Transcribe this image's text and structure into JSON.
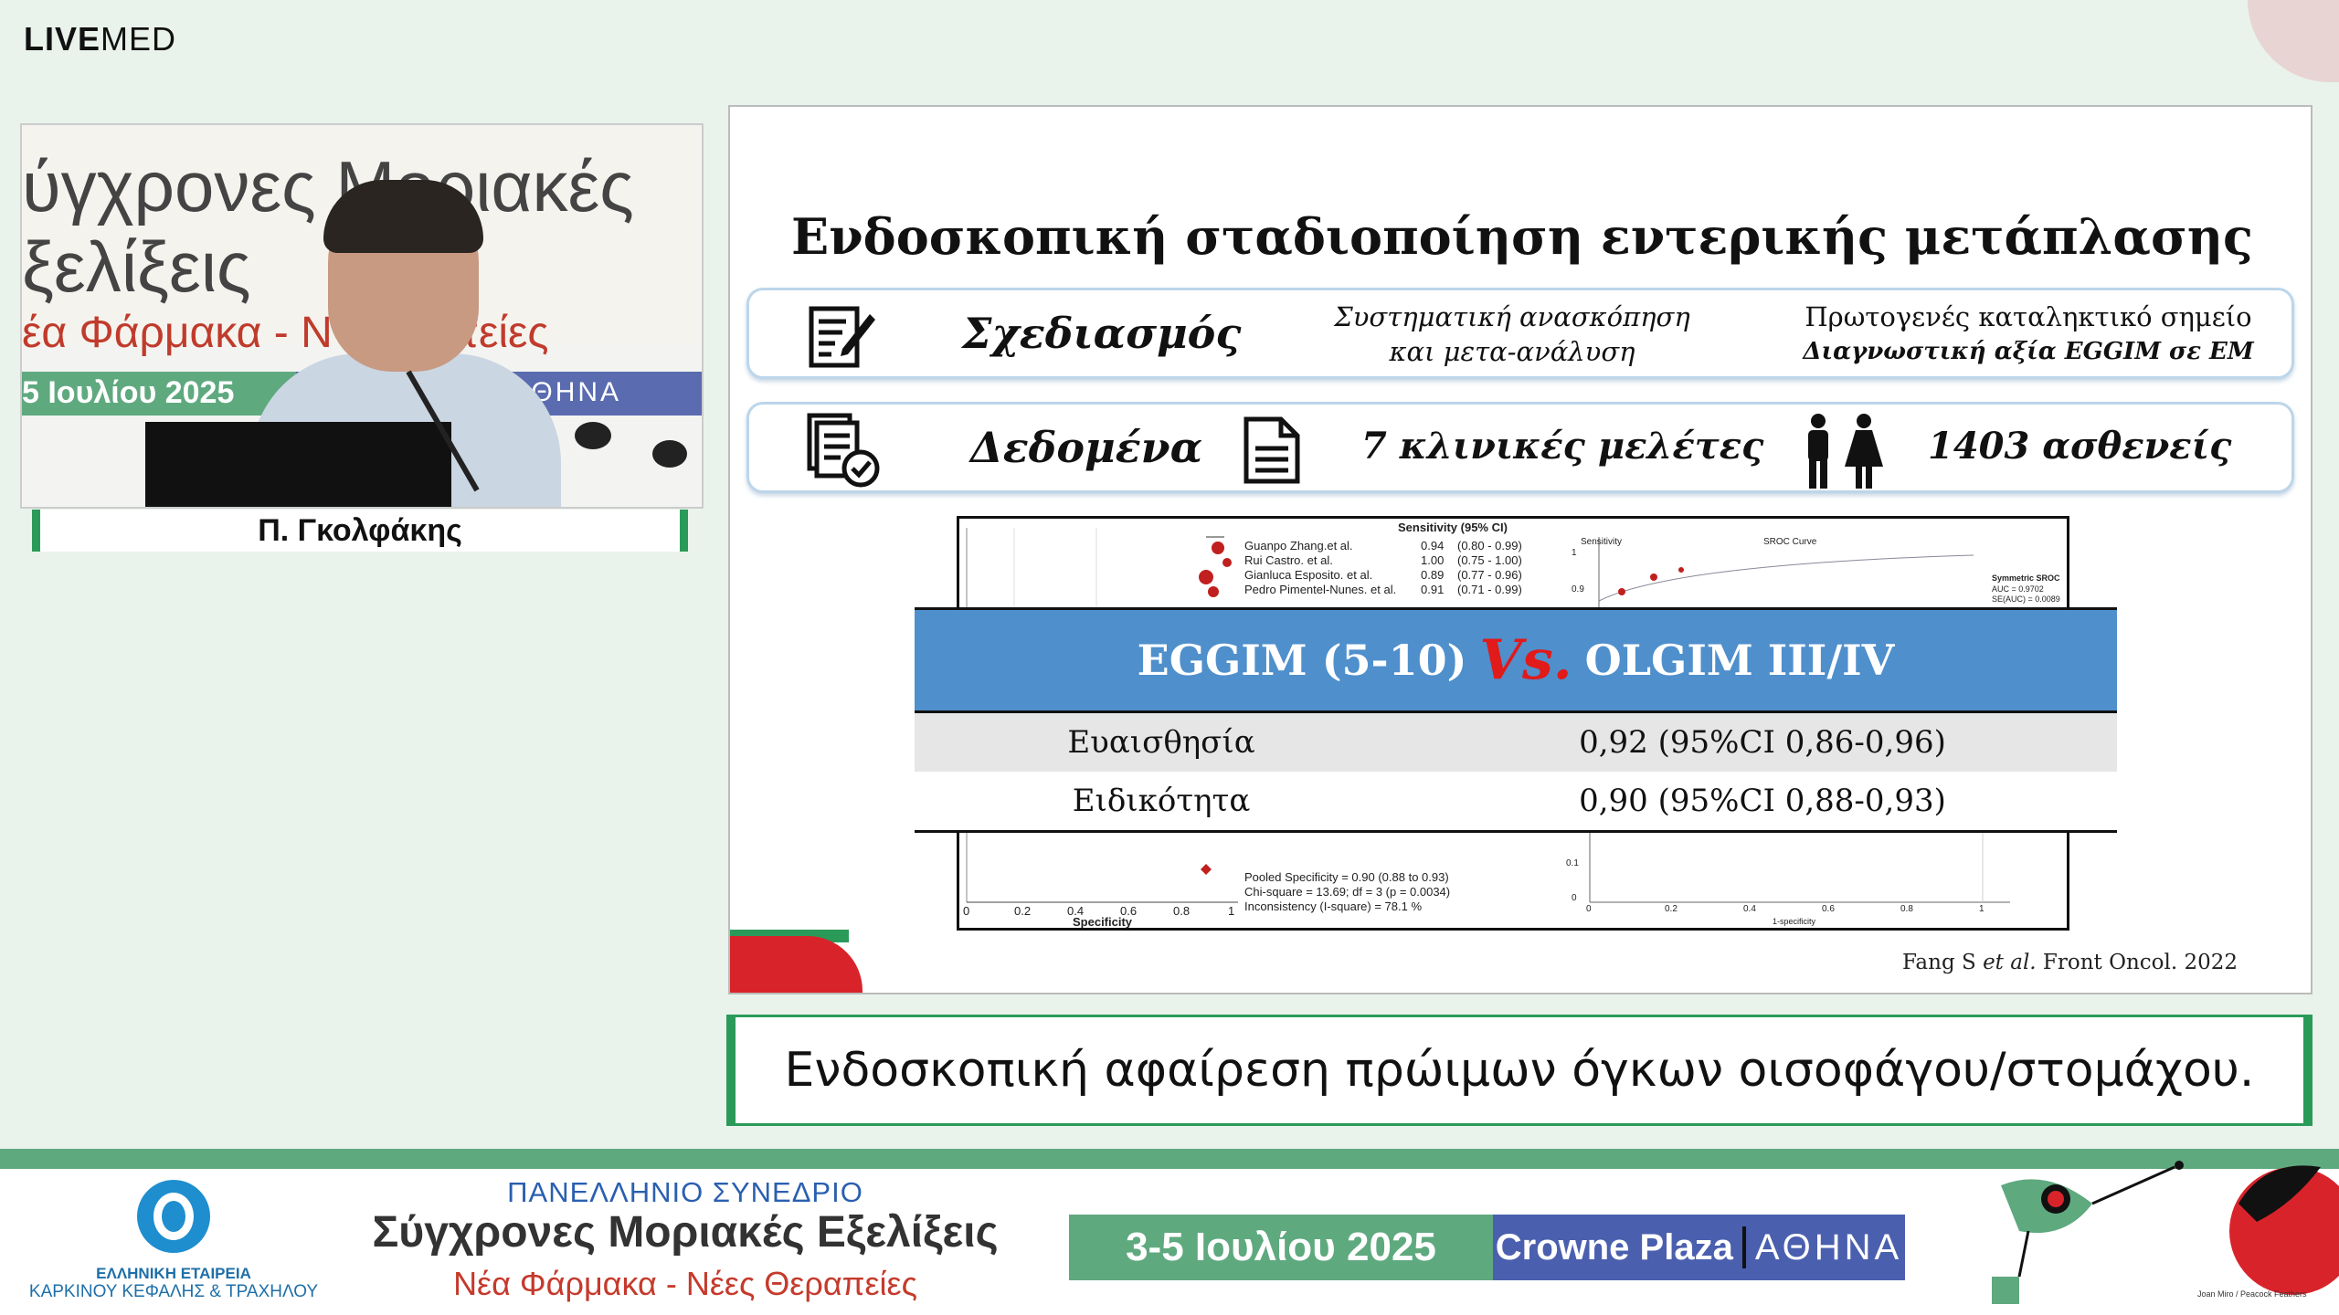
{
  "brand": {
    "bold": "LIVE",
    "light": "MED"
  },
  "speaker": {
    "name": "Π. Γκολφάκης"
  },
  "video": {
    "line1": "ύγχρονες Μοριακές",
    "line2": "ξελίξεις",
    "line3": "έα Φάρμακα - Ν    Θεραπείες",
    "line4": "5 Ιουλίου 2025",
    "city": "ΑΘΗΝΑ"
  },
  "slide": {
    "title": "Ενδοσκοπική σταδιοποίηση εντερικής μετάπλασης",
    "pill1": {
      "label": "Σχεδιασμός",
      "icon": "document-edit-icon",
      "col2_line1": "Συστηματική ανασκόπηση",
      "col2_line2": "και μετα-ανάλυση",
      "col3_line1": "Πρωτογενές καταληκτικό σημείο",
      "col3_line2": "Διαγνωστική αξία EGGIM σε ΕΜ"
    },
    "pill2": {
      "label": "Δεδομένα",
      "icon": "checklist-icon",
      "studies_icon": "document-icon",
      "studies": "7 κλινικές μελέτες",
      "patients_icon": "people-icon",
      "patients": "1403 ασθενείς"
    },
    "forest": {
      "header": "Sensitivity (95% CI)",
      "rows": [
        {
          "study": "Guanpo Zhang.et al.",
          "est": "0.94",
          "ci": "(0.80 - 0.99)"
        },
        {
          "study": "Rui Castro. et al.",
          "est": "1.00",
          "ci": "(0.75 - 1.00)"
        },
        {
          "study": "Gianluca Esposito. et al.",
          "est": "0.89",
          "ci": "(0.77 - 0.96)"
        },
        {
          "study": "Pedro Pimentel-Nunes. et al.",
          "est": "0.91",
          "ci": "(0.71 - 0.99)"
        }
      ],
      "sroc_title": "SROC Curve",
      "sroc_ylabel": "Sensitivity",
      "sroc_legend1": "Symmetric SROC",
      "sroc_legend2": "AUC = 0.9702",
      "sroc_legend3": "SE(AUC) = 0.0089",
      "sroc_ytick": "0.9",
      "sroc_ytick_top": "1",
      "pooled": "Pooled Specificity = 0.90 (0.88 to 0.93)",
      "chisq": "Chi-square = 13.69; df = 3 (p = 0.0034)",
      "incons": "Inconsistency (I-square) = 78.1 %",
      "xaxis_ticks": [
        "0",
        "0.2",
        "0.4",
        "0.6",
        "0.8",
        "1"
      ],
      "xlabel": "Specificity",
      "sroc_xticks": [
        "0",
        "0.2",
        "0.4",
        "0.6",
        "0.8",
        "1"
      ],
      "sroc_xlabel": "1-specificity",
      "sroc_yticks_low": [
        "0.1",
        "0"
      ]
    },
    "table": {
      "head_left": "EGGIM (5-10)",
      "head_vs": "Vs.",
      "head_right": "OLGIM III/IV",
      "rows": [
        {
          "label": "Ευαισθησία",
          "value": "0,92 (95%CI 0,86-0,96)"
        },
        {
          "label": "Ειδικότητα",
          "value": "0,90 (95%CI 0,88-0,93)"
        }
      ]
    },
    "citation_author": "Fang S ",
    "citation_etal": "et al.",
    "citation_rest": " Front Oncol. 2022"
  },
  "subtitle": "Ενδοσκοπική αφαίρεση πρώιμων όγκων οισοφάγου/στομάχου.",
  "bottom": {
    "org_line1": "ΕΛΛΗΝΙΚΗ ΕΤΑΙΡΕΙΑ",
    "org_line2": "ΚΑΡΚΙΝΟΥ ΚΕΦΑΛΗΣ & ΤΡΑΧΗΛΟΥ",
    "conf_kind": "ΠΑΝΕΛΛΗΝΙΟ ΣΥΝΕΔΡΙΟ",
    "conf_name": "Σύγχρονες Μοριακές Εξελίξεις",
    "conf_sub": "Νέα Φάρμακα - Νέες Θεραπείες",
    "date": "3-5 Ιουλίου 2025",
    "venue": "Crowne Plaza",
    "city": "ΑΘΗΝΑ",
    "art_caption": "Joan Miro / Peacock Feathers"
  },
  "colors": {
    "green": "#2a9a59",
    "table_blue": "#4f8fcc",
    "vs_red": "#e11a1a",
    "venue_blue": "#4a5fae"
  }
}
